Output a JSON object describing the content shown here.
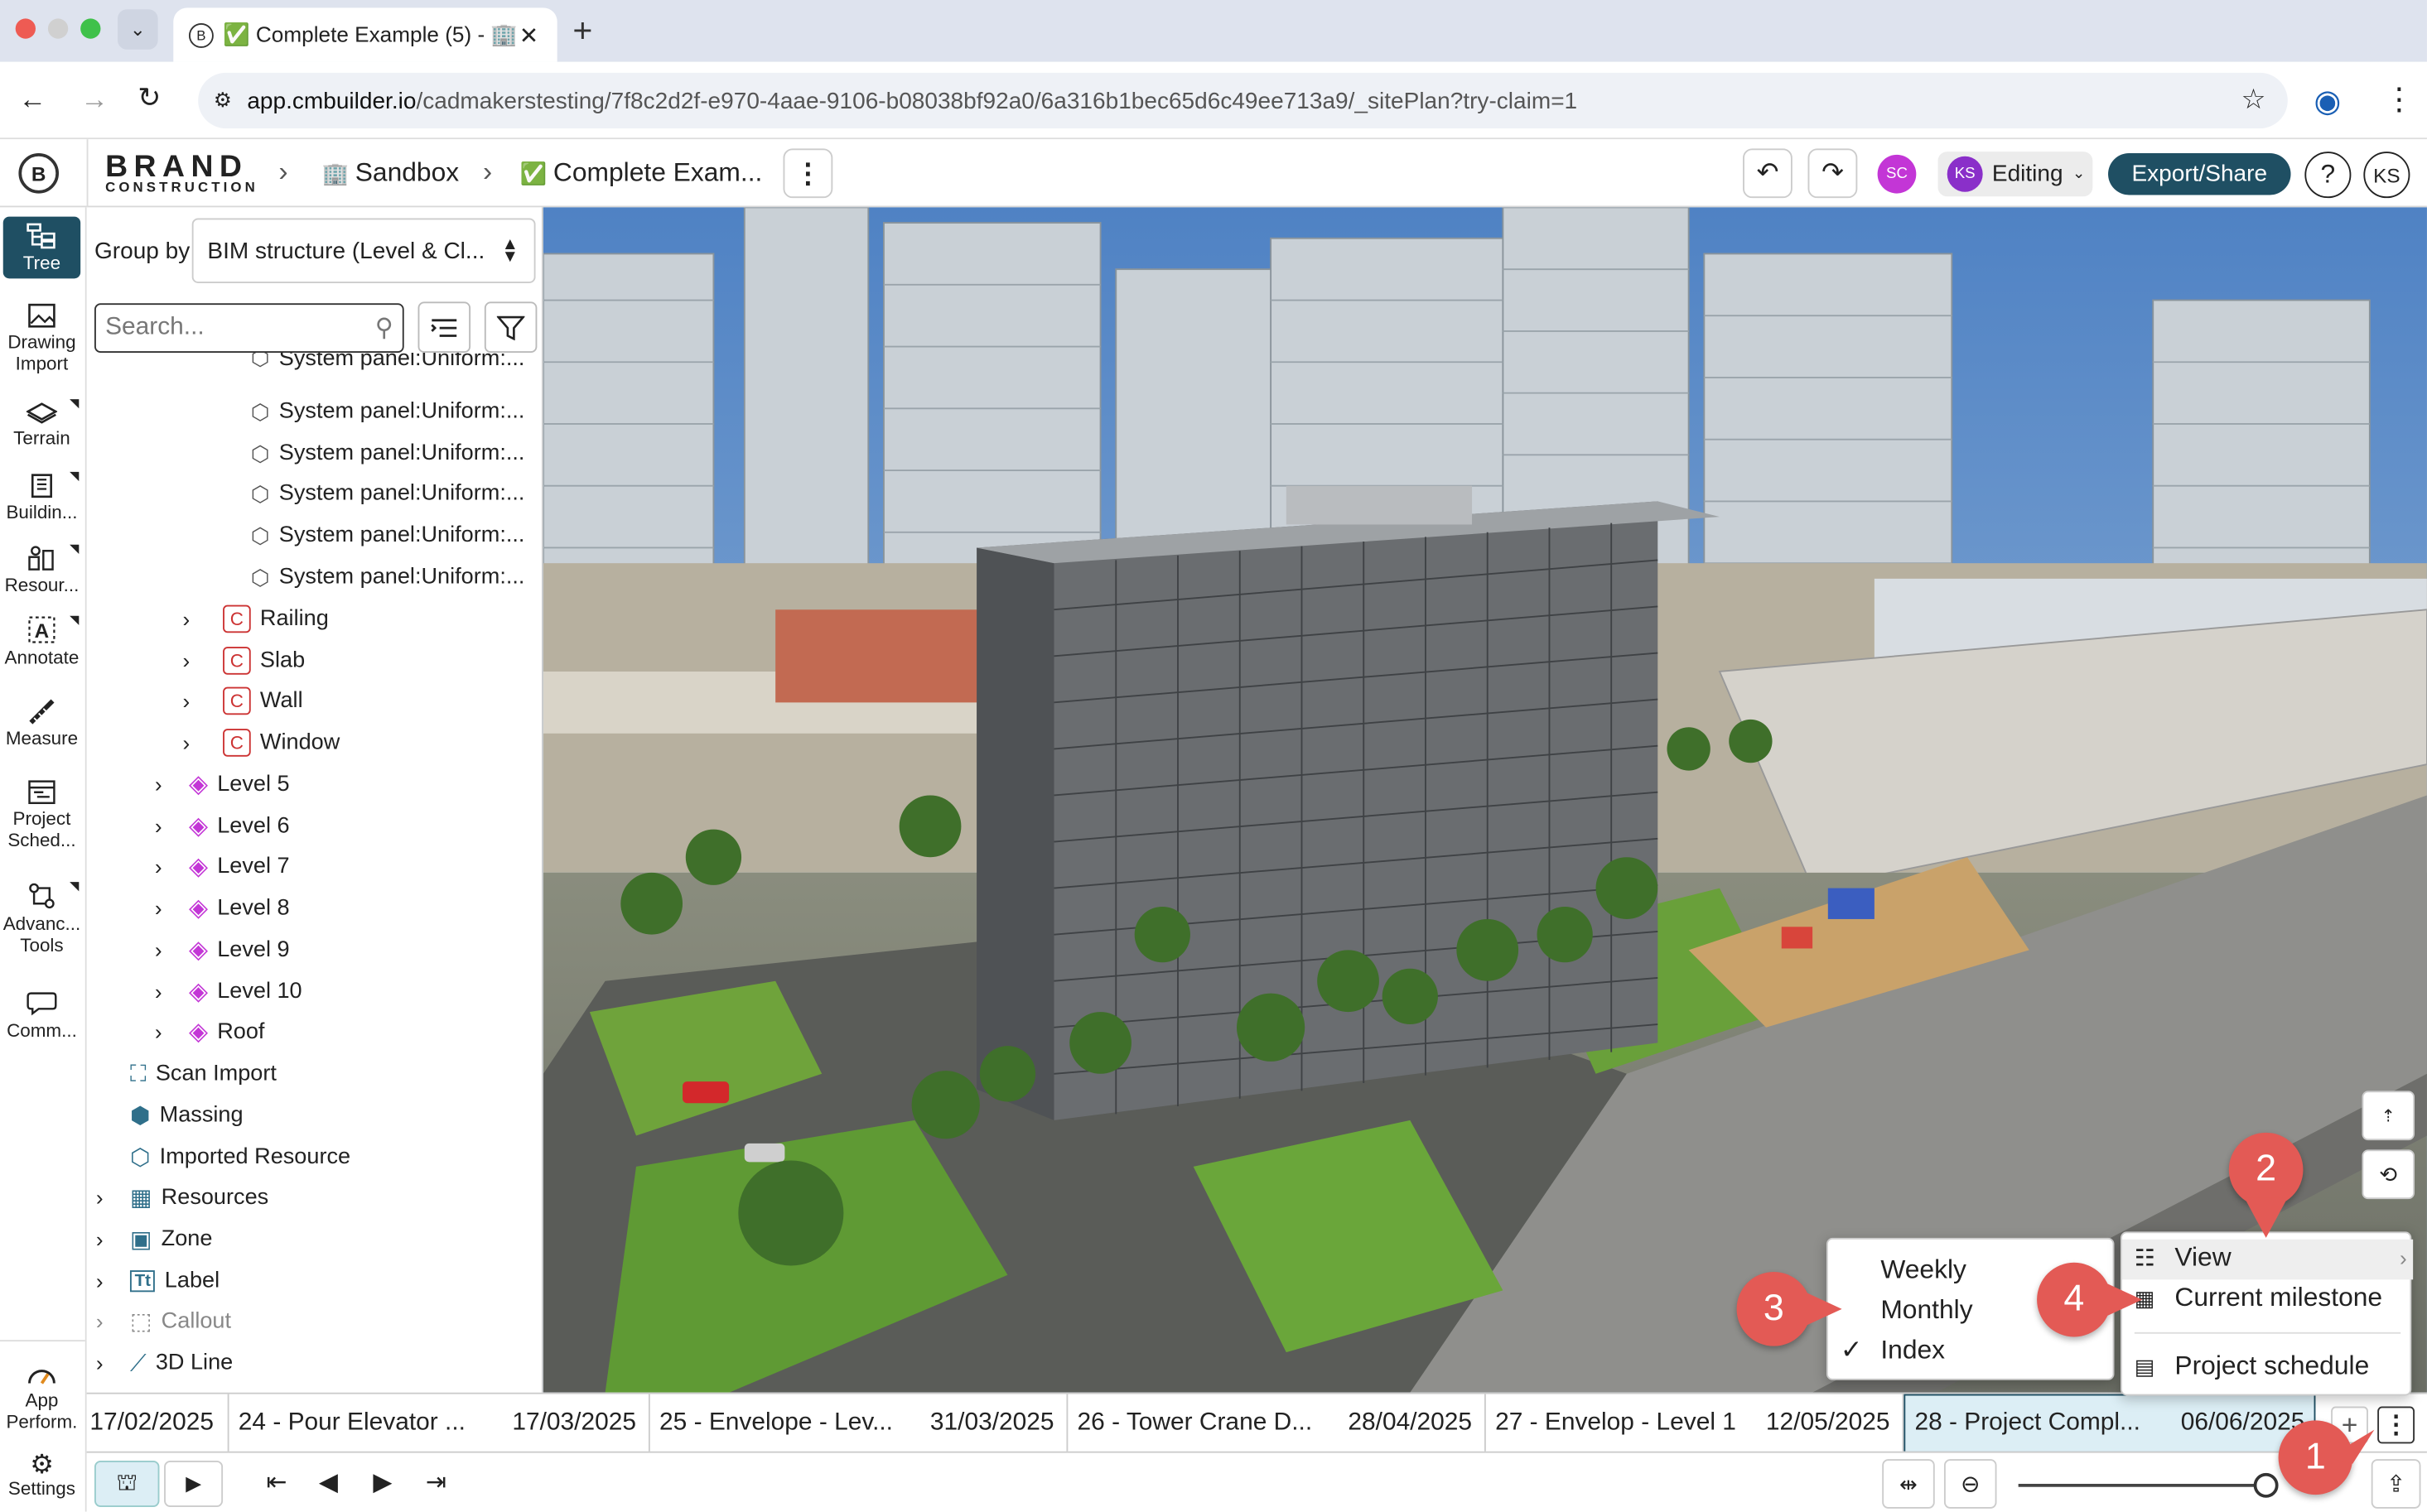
{
  "browser": {
    "tab_title": "✅ Complete Example (5) - 🏢",
    "url_host": "app.cmbuilder.io",
    "url_path": "/cadmakerstesting/7f8c2d2f-e970-4aae-9106-b08038bf92a0/6a316b1bec65d6c49ee713a9/_sitePlan?try-claim=1"
  },
  "header": {
    "brand_top": "BRAND",
    "brand_bottom": "CONSTRUCTION",
    "crumb_project": "Sandbox",
    "crumb_project_icon": "🏢",
    "crumb_page": "Complete Exam...",
    "crumb_page_icon": "✅",
    "user_sc": "SC",
    "user_ks": "KS",
    "mode_label": "Editing",
    "export_label": "Export/Share",
    "help_label": "?",
    "avatar_label": "KS",
    "colors": {
      "accent": "#1f4f63",
      "user": "#c336d6"
    }
  },
  "rail": {
    "tree": "Tree",
    "drawing_import_1": "Drawing",
    "drawing_import_2": "Import",
    "terrain": "Terrain",
    "building": "Buildin...",
    "resources": "Resour...",
    "annotate": "Annotate",
    "measure": "Measure",
    "project_1": "Project",
    "project_2": "Sched...",
    "advanced_1": "Advanc...",
    "advanced_2": "Tools",
    "comments": "Comm...",
    "perf_1": "App",
    "perf_2": "Perform.",
    "settings": "Settings"
  },
  "panel": {
    "group_by_label": "Group by",
    "group_by_value": "BIM structure (Level & Cl...",
    "search_placeholder": "Search...",
    "partial_row": "System panel:Uniform:...",
    "system_panel_rows": [
      "System panel:Uniform:...",
      "System panel:Uniform:...",
      "System panel:Uniform:...",
      "System panel:Uniform:...",
      "System panel:Uniform:..."
    ],
    "class_rows": [
      "Railing",
      "Slab",
      "Wall",
      "Window"
    ],
    "level_rows": [
      "Level 5",
      "Level 6",
      "Level 7",
      "Level 8",
      "Level 9",
      "Level 10",
      "Roof"
    ],
    "misc_rows": [
      "Scan Import",
      "Massing",
      "Imported Resource"
    ],
    "group_rows": [
      "Resources",
      "Zone",
      "Label",
      "Callout",
      "3D Line"
    ]
  },
  "timeline": {
    "start_date": "17/02/2025",
    "segments": [
      {
        "label": "24 - Pour Elevator ...",
        "date": "17/03/2025"
      },
      {
        "label": "25 - Envelope - Lev...",
        "date": "31/03/2025"
      },
      {
        "label": "26 - Tower Crane D...",
        "date": "28/04/2025"
      },
      {
        "label": "27 - Envelop - Level 1",
        "date": "12/05/2025"
      },
      {
        "label": "28 - Project Compl...",
        "date": "06/06/2025"
      }
    ]
  },
  "submenu": {
    "items": [
      "Weekly",
      "Monthly",
      "Index"
    ],
    "checked": "Index"
  },
  "menu": {
    "view": "View",
    "current_milestone": "Current milestone",
    "project_schedule": "Project schedule"
  },
  "badges": [
    "1",
    "2",
    "3",
    "4"
  ]
}
